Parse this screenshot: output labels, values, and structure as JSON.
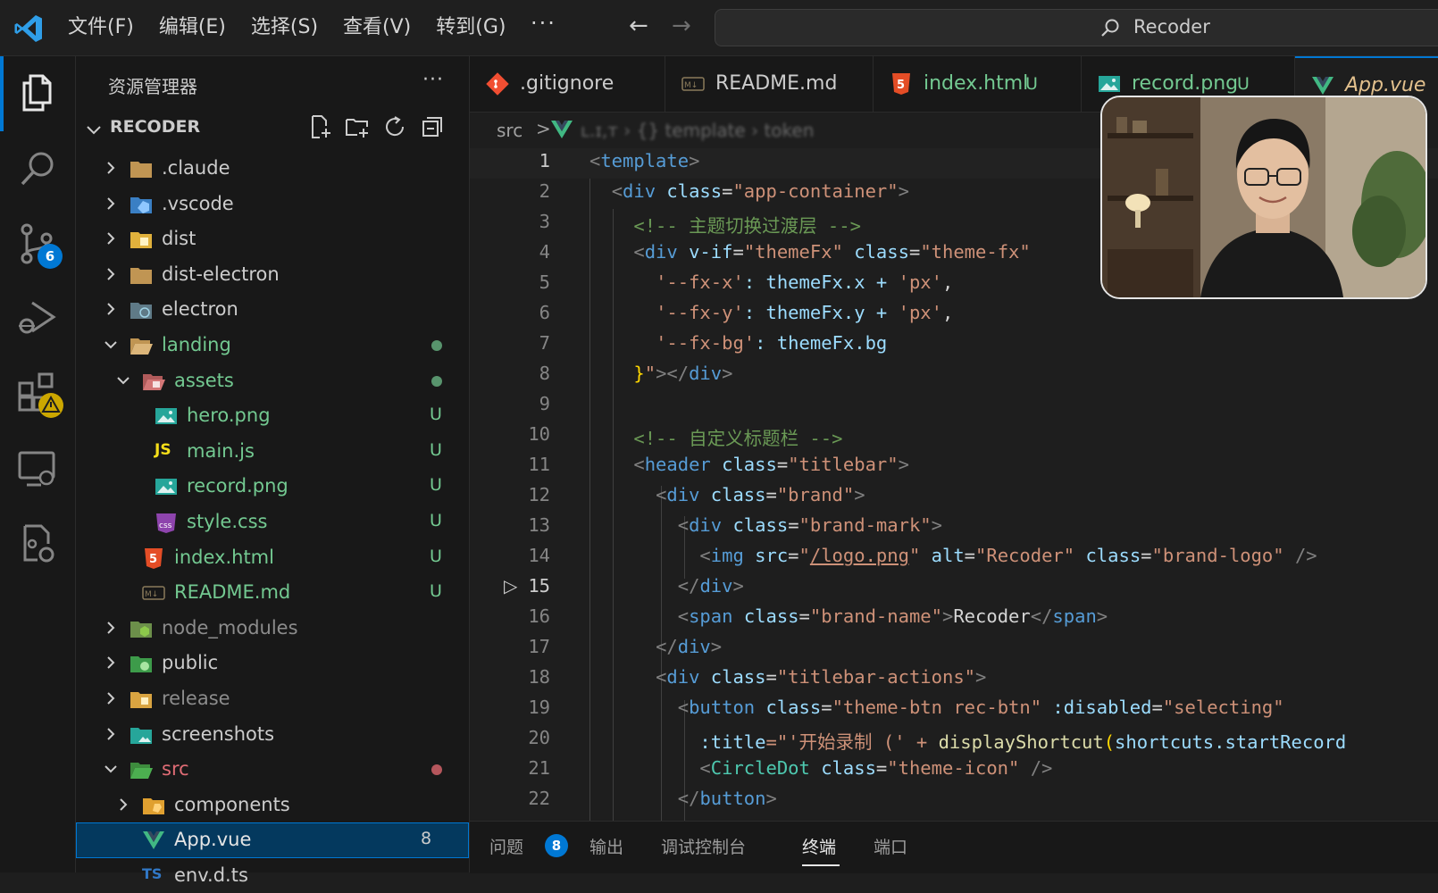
{
  "menu": {
    "items": [
      "文件(F)",
      "编辑(E)",
      "选择(S)",
      "查看(V)",
      "转到(G)"
    ],
    "more": "···",
    "back_icon": "arrow-left-icon",
    "forward_icon": "arrow-right-icon"
  },
  "search": {
    "text": "Recoder",
    "icon": "search-icon"
  },
  "activity": {
    "items": [
      "explorer-icon",
      "search-icon",
      "source-control-icon",
      "run-debug-icon",
      "extensions-icon",
      "remote-explorer-icon",
      "settings-sync-icon"
    ],
    "scm_badge": "6"
  },
  "sidebar": {
    "title": "资源管理器",
    "more": "···",
    "root": "RECODER",
    "actions": [
      "new-file-icon",
      "new-folder-icon",
      "refresh-icon",
      "collapse-all-icon"
    ],
    "tree": [
      {
        "name": ".claude",
        "status": "",
        "color": "#cccccc"
      },
      {
        "name": ".vscode",
        "status": "",
        "color": "#cccccc"
      },
      {
        "name": "dist",
        "status": "",
        "color": "#cccccc"
      },
      {
        "name": "dist-electron",
        "status": "",
        "color": "#cccccc"
      },
      {
        "name": "electron",
        "status": "",
        "color": "#cccccc"
      },
      {
        "name": "landing",
        "status": "",
        "color": "#73c991"
      },
      {
        "name": "assets",
        "status": "",
        "color": "#73c991"
      },
      {
        "name": "hero.png",
        "status": "U",
        "color": "#73c991"
      },
      {
        "name": "main.js",
        "status": "U",
        "color": "#73c991"
      },
      {
        "name": "record.png",
        "status": "U",
        "color": "#73c991"
      },
      {
        "name": "style.css",
        "status": "U",
        "color": "#73c991"
      },
      {
        "name": "index.html",
        "status": "U",
        "color": "#73c991"
      },
      {
        "name": "README.md",
        "status": "U",
        "color": "#73c991"
      },
      {
        "name": "node_modules",
        "status": "",
        "color": "#8c8c8c"
      },
      {
        "name": "public",
        "status": "",
        "color": "#cccccc"
      },
      {
        "name": "release",
        "status": "",
        "color": "#8c8c8c"
      },
      {
        "name": "screenshots",
        "status": "",
        "color": "#cccccc"
      },
      {
        "name": "src",
        "status": "",
        "color": "#e06c75"
      },
      {
        "name": "components",
        "status": "",
        "color": "#cccccc"
      },
      {
        "name": "App.vue",
        "status": "8",
        "color": "#e5e5e5"
      },
      {
        "name": "env.d.ts",
        "status": "",
        "color": "#cccccc"
      }
    ]
  },
  "tabs": [
    {
      "label": ".gitignore",
      "status": "",
      "color": "#cccccc"
    },
    {
      "label": "README.md",
      "status": "",
      "color": "#cccccc"
    },
    {
      "label": "index.html",
      "status": "U",
      "color": "#73c991"
    },
    {
      "label": "record.png",
      "status": "U",
      "color": "#73c991"
    },
    {
      "label": "App.vue",
      "status": "",
      "color": "#e2c08d"
    }
  ],
  "breadcrumb": {
    "folder": "src",
    "sep": ">",
    "blurred": "ʟ.ɪ,ᴛ  › {} template  ›  token"
  },
  "editor": {
    "lines": [
      "1",
      "2",
      "3",
      "4",
      "5",
      "6",
      "7",
      "8",
      "9",
      "10",
      "11",
      "12",
      "13",
      "14",
      "15",
      "16",
      "17",
      "18",
      "19",
      "20",
      "21",
      "22"
    ],
    "code": {
      "l1": [
        "template"
      ],
      "l2": [
        "div",
        "class",
        "\"app-container\""
      ],
      "l3": "<!-- 主题切换过渡层 -->",
      "l4": [
        "div",
        "v-if",
        "\"themeFx\"",
        "class",
        "\"theme-fx\""
      ],
      "l5": [
        "'--fx-x'",
        ": themeFx.x + ",
        "'px'",
        ","
      ],
      "l6": [
        "'--fx-y'",
        ": themeFx.y + ",
        "'px'",
        ","
      ],
      "l7": [
        "'--fx-bg'",
        ": themeFx.bg"
      ],
      "l8": [
        "}",
        "\"",
        "></",
        "div",
        ">"
      ],
      "l10": "<!-- 自定义标题栏 -->",
      "l11": [
        "header",
        "class",
        "\"titlebar\""
      ],
      "l12": [
        "div",
        "class",
        "\"brand\""
      ],
      "l13": [
        "div",
        "class",
        "\"brand-mark\""
      ],
      "l14": [
        "img",
        "src",
        "\"",
        "/logo.png",
        "\"",
        "alt",
        "\"Recoder\"",
        "class",
        "\"brand-logo\"",
        " />"
      ],
      "l15": [
        "div"
      ],
      "l16": [
        "span",
        "class",
        "\"brand-name\"",
        "Recoder",
        "span"
      ],
      "l17": [
        "div"
      ],
      "l18": [
        "div",
        "class",
        "\"titlebar-actions\""
      ],
      "l19": [
        "button",
        "class",
        "\"theme-btn rec-btn\"",
        ":disabled",
        "\"selecting\""
      ],
      "l20": [
        ":title",
        "=\"'开始录制 (' + ",
        "displayShortcut",
        "(",
        "shortcuts.startRecord"
      ],
      "l21": [
        "CircleDot",
        "class",
        "\"theme-icon\"",
        " />"
      ],
      "l22": [
        "button"
      ]
    }
  },
  "panel": {
    "tabs": [
      "问题",
      "输出",
      "调试控制台",
      "终端",
      "端口"
    ],
    "problems_badge": "8"
  },
  "webcam": {
    "description_icon": "webcam-presenter-icon"
  }
}
